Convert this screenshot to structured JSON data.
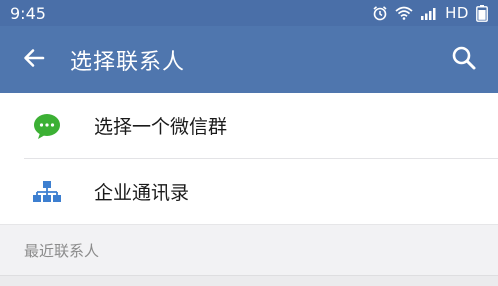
{
  "status_bar": {
    "time": "9:45",
    "network_label": "HD",
    "icons": [
      "alarm-icon",
      "wifi-icon",
      "signal-icon"
    ]
  },
  "app_bar": {
    "title": "选择联系人",
    "back_icon": "arrow-left-icon",
    "search_icon": "search-icon",
    "color": "#4f76ae"
  },
  "list": {
    "items": [
      {
        "label": "选择一个微信群",
        "icon": "wechat-group-icon",
        "icon_color": "#3cb034"
      },
      {
        "label": "企业通讯录",
        "icon": "org-chart-icon",
        "icon_color": "#3d7fd0"
      }
    ]
  },
  "section": {
    "title": "最近联系人"
  }
}
